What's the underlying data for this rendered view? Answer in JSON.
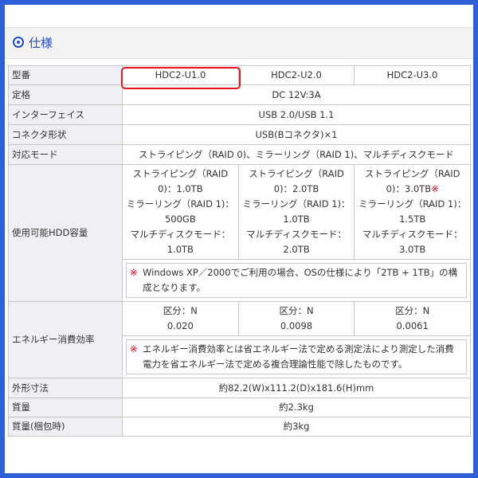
{
  "section_title": "仕様",
  "models": [
    "HDC2-U1.0",
    "HDC2-U2.0",
    "HDC2-U3.0"
  ],
  "rows": {
    "model_label": "型番",
    "rating_label": "定格",
    "rating_value": "DC 12V:3A",
    "interface_label": "インターフェイス",
    "interface_value": "USB 2.0/USB 1.1",
    "connector_label": "コネクタ形状",
    "connector_value": "USB(Bコネクタ)×1",
    "mode_label": "対応モード",
    "mode_value": "ストライピング（RAID 0)、ミラーリング（RAID 1)、マルチディスクモード",
    "capacity_label": "使用可能HDD容量",
    "capacity": [
      {
        "stripe": "ストライピング（RAID 0)：1.0TB",
        "mark": "",
        "mirror": "ミラーリング（RAID 1)：500GB",
        "multi": "マルチディスクモード：1.0TB"
      },
      {
        "stripe": "ストライピング（RAID 0)：2.0TB",
        "mark": "",
        "mirror": "ミラーリング（RAID 1)：1.0TB",
        "multi": "マルチディスクモード：2.0TB"
      },
      {
        "stripe": "ストライピング（RAID 0)：3.0TB",
        "mark": "※",
        "mirror": "ミラーリング（RAID 1)：1.5TB",
        "multi": "マルチディスクモード：3.0TB"
      }
    ],
    "capacity_note_mark": "※",
    "capacity_note": "Windows XP／2000でご利用の場合、OSの仕様により「2TB + 1TB」の構成となります。",
    "energy_label": "エネルギー消費効率",
    "energy": [
      {
        "class": "区分：N",
        "value": "0.020"
      },
      {
        "class": "区分：N",
        "value": "0.0098"
      },
      {
        "class": "区分：N",
        "value": "0.0061"
      }
    ],
    "energy_note_mark": "※",
    "energy_note": "エネルギー消費効率とは省エネルギー法で定める測定法により測定した消費電力を省エネルギー法で定める複合理論性能で除したものです。",
    "dimensions_label": "外形寸法",
    "dimensions_value": "約82.2(W)x111.2(D)x181.6(H)mm",
    "weight_label": "質量",
    "weight_value": "約2.3kg",
    "packed_weight_label": "質量(梱包時)",
    "packed_weight_value": "約3kg"
  },
  "colors": {
    "border": "#2f5fd6",
    "title": "#1f4fbf",
    "highlight": "#e8141a",
    "asterisk": "#d0021b"
  }
}
